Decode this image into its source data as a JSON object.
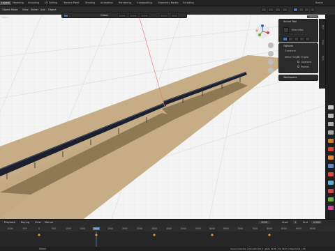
{
  "workspace_tabs": [
    "Layout",
    "Modeling",
    "Sculpting",
    "UV Editing",
    "Texture Paint",
    "Shading",
    "Animation",
    "Rendering",
    "Compositing",
    "Geometry Nodes",
    "Scripting"
  ],
  "active_tab_index": 0,
  "scene_label": "Scene",
  "header": {
    "mode_label": "Object Mode",
    "menu": [
      "View",
      "Select",
      "Add",
      "Object"
    ]
  },
  "tool_header": {
    "orientation": "Global"
  },
  "viewport_info": "Object",
  "npanel": {
    "active_tool_title": "Active Tool",
    "tool_name": "Select Box",
    "options_title": "Options",
    "transform_title": "Transform",
    "affect_only_label": "Affect Only",
    "checkboxes": [
      "Origins",
      "Locations",
      "Parents"
    ],
    "workspace_title": "Workspace",
    "options_button": "Options"
  },
  "side_tabs": [
    "Tool",
    "View",
    "Item"
  ],
  "timeline": {
    "menu": [
      "Playback",
      "Keying",
      "View",
      "Marker"
    ],
    "current_frame": "3000",
    "start_label": "Start",
    "start_value": "1",
    "end_label": "End",
    "end_value": "10000",
    "ticks": [
      "-1000",
      "-500",
      "0",
      "500",
      "1000",
      "1500",
      "2000",
      "2500",
      "3000",
      "3500",
      "4000",
      "4500",
      "5000",
      "5500",
      "6000",
      "6500",
      "7000",
      "7500",
      "8000",
      "8500",
      "9000",
      "9500"
    ]
  },
  "status": {
    "left": "Select",
    "right": "Scene Collection | Monolith Edit 2 | Verts 34,9K | Tris 38.7k | Objects 0/1 | 3.6"
  },
  "colors": {
    "ground": "#c6ad86",
    "grass": "#8d7a55",
    "panel": "#1c2030",
    "accent": "#4a72b0"
  }
}
